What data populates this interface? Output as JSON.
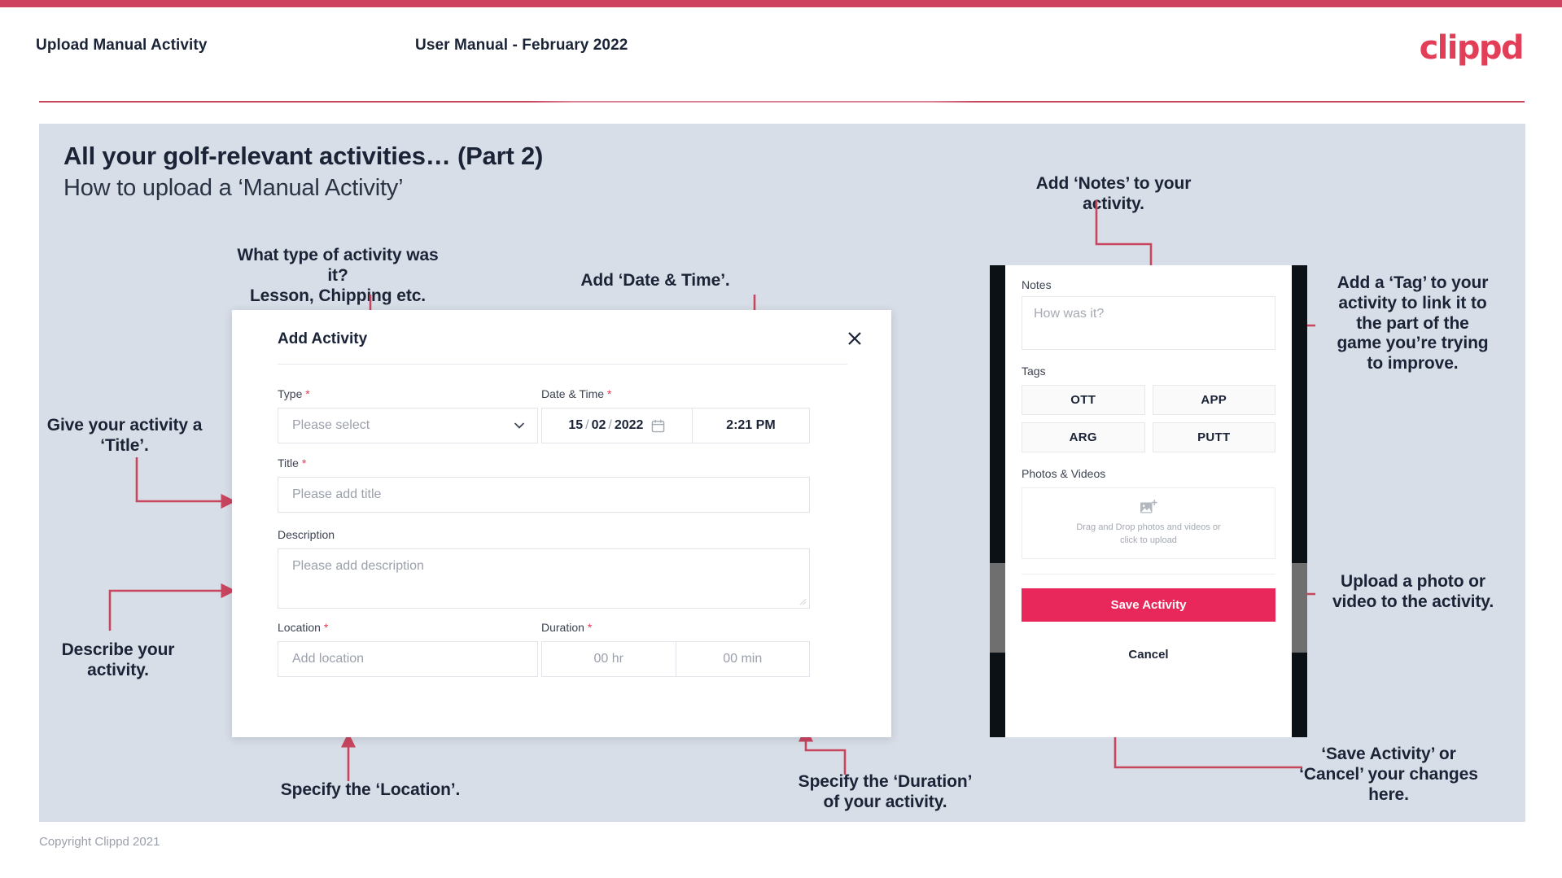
{
  "header": {
    "title": "Upload Manual Activity",
    "subtitle": "User Manual - February 2022",
    "logo": "clippd"
  },
  "slide": {
    "title": "All your golf-relevant activities… (Part 2)",
    "subtitle": "How to upload a ‘Manual Activity’"
  },
  "annotations": {
    "type": "What type of activity was it?\nLesson, Chipping etc.",
    "datetime": "Add ‘Date & Time’.",
    "title": "Give your activity a\n‘Title’.",
    "description": "Describe your\nactivity.",
    "location": "Specify the ‘Location’.",
    "duration": "Specify the ‘Duration’\nof your activity.",
    "notes": "Add ‘Notes’ to your\nactivity.",
    "tags": "Add a ‘Tag’ to your\nactivity to link it to\nthe part of the\ngame you’re trying\nto improve.",
    "photos": "Upload a photo or\nvideo to the activity.",
    "save": "‘Save Activity’ or\n‘Cancel’ your changes\nhere."
  },
  "dialog": {
    "title": "Add Activity",
    "close_icon": "close-icon",
    "fields": {
      "type": {
        "label": "Type",
        "required": "*",
        "placeholder": "Please select"
      },
      "datetime": {
        "label": "Date & Time",
        "required": "*",
        "day": "15",
        "month": "02",
        "year": "2022",
        "sep": "/",
        "time": "2:21 PM"
      },
      "title": {
        "label": "Title",
        "required": "*",
        "placeholder": "Please add title"
      },
      "description": {
        "label": "Description",
        "required": "",
        "placeholder": "Please add description"
      },
      "location": {
        "label": "Location",
        "required": "*",
        "placeholder": "Add location"
      },
      "duration": {
        "label": "Duration",
        "required": "*",
        "hours": "00 hr",
        "minutes": "00 min"
      }
    }
  },
  "phone": {
    "notes": {
      "label": "Notes",
      "placeholder": "How was it?"
    },
    "tags": {
      "label": "Tags",
      "items": [
        "OTT",
        "APP",
        "ARG",
        "PUTT"
      ]
    },
    "photos": {
      "label": "Photos & Videos",
      "dropzone_line1": "Drag and Drop photos and videos or",
      "dropzone_line2": "click to upload",
      "icon": "add-image-icon"
    },
    "save_label": "Save Activity",
    "cancel_label": "Cancel"
  },
  "footer": {
    "copyright": "Copyright Clippd 2021"
  },
  "colors": {
    "accent": "#e8275a",
    "bar": "#cd4360",
    "arrow": "#c8455e",
    "slide_bg": "#d8dee7",
    "text": "#1b2437"
  }
}
